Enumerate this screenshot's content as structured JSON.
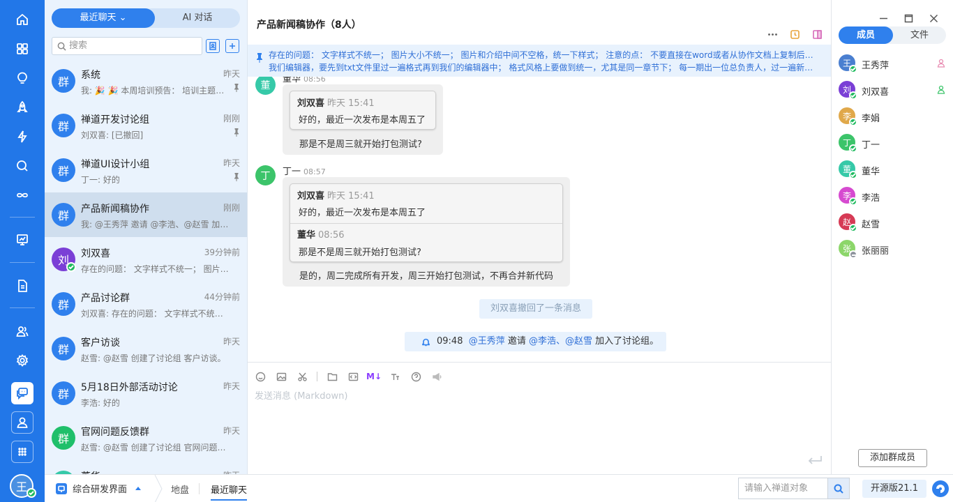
{
  "colors": {
    "brand": "#2277e8",
    "accent": "#2f80ed",
    "online": "#1fba5e"
  },
  "leftbar": {
    "icons": [
      "home-icon",
      "apps-icon",
      "lightbulb-icon",
      "rocket-icon",
      "lightning-icon",
      "search-icon",
      "infinity-icon",
      "presentation-icon",
      "document-icon",
      "users-icon",
      "gear-icon",
      "chat-icon",
      "contact-icon",
      "grid-icon"
    ],
    "user_avatar": "王"
  },
  "chatlist": {
    "tab_recent": "最近聊天",
    "tab_ai": "AI 对话",
    "search_placeholder": "搜索",
    "items": [
      {
        "avatar": "群",
        "color": "#2f80ed",
        "name": "系统",
        "time": "昨天",
        "preview": "我: 🎉 🎉 本周培训预告： 培训主题： 进阶版本功能介绍",
        "pinned": true
      },
      {
        "avatar": "群",
        "color": "#2f80ed",
        "name": "禅道开发讨论组",
        "time": "刚刚",
        "preview": "刘双喜: [已撤回]",
        "pinned": true
      },
      {
        "avatar": "群",
        "color": "#2f80ed",
        "name": "禅道UI设计小组",
        "time": "昨天",
        "preview": "丁一: 好的",
        "pinned": true
      },
      {
        "avatar": "群",
        "color": "#2f80ed",
        "name": "产品新闻稿协作",
        "time": "刚刚",
        "preview": "我: @王秀萍 邀请 @李浩、@赵雪 加入了讨论组。",
        "pinned": false,
        "selected": true
      },
      {
        "avatar": "刘",
        "color": "#7a3fd6",
        "name": "刘双喜",
        "time": "39分钟前",
        "preview": "存在的问题： 文字样式不统一； 图片大小不统一；",
        "pinned": false,
        "online": true
      },
      {
        "avatar": "群",
        "color": "#2f80ed",
        "name": "产品讨论群",
        "time": "44分钟前",
        "preview": "刘双喜: 存在的问题： 文字样式不统一； 图片大小不统一",
        "pinned": false
      },
      {
        "avatar": "群",
        "color": "#2f80ed",
        "name": "客户访谈",
        "time": "昨天",
        "preview": "赵雪: @赵雪 创建了讨论组 客户访谈。",
        "pinned": false
      },
      {
        "avatar": "群",
        "color": "#2f80ed",
        "name": "5月18日外部活动讨论",
        "time": "昨天",
        "preview": "李浩: 好的",
        "pinned": false
      },
      {
        "avatar": "群",
        "color": "#1fbf6a",
        "name": "官网问题反馈群",
        "time": "昨天",
        "preview": "赵雪: @赵雪 创建了讨论组 官网问题反馈群。",
        "pinned": false
      },
      {
        "avatar": "董",
        "color": "#36c9a8",
        "name": "董华",
        "time": "昨天",
        "preview": "",
        "pinned": false
      }
    ]
  },
  "chat": {
    "title": "产品新闻稿协作（8人）",
    "notice_line1": "存在的问题： 文字样式不统一； 图片大小不统一； 图片和介绍中间不空格，统一下样式； 注意的点： 不要直接在word或者从协作文档上复制后放入",
    "notice_line2": "我们编辑器，要先到txt文件里过一遍格式再到我们的编辑器中； 格式风格上要做到统一，尤其是同一章节下； 每一期出一位总负责人，过一遍新闻稿，检查格式",
    "msg1": {
      "sender": "董华",
      "time": "08:56",
      "avatar": "董",
      "quote_name": "刘双喜",
      "quote_time": "昨天 15:41",
      "quote_text": "好的，最近一次发布是本周五了",
      "text": "那是不是周三就开始打包测试?"
    },
    "msg2": {
      "sender": "丁一",
      "time": "08:57",
      "avatar": "丁",
      "quote_name": "刘双喜",
      "quote_time": "昨天 15:41",
      "quote_text": "好的，最近一次发布是本周五了",
      "quote2_name": "董华",
      "quote2_time": "08:56",
      "quote2_text": "那是不是周三就开始打包测试?",
      "text": "是的，周二完成所有开发，周三开始打包测试，不再合并新代码"
    },
    "recall_notice": "刘双喜撤回了一条消息",
    "sys_time": "09:48",
    "sys_inviter": "@王秀萍",
    "sys_invite": " 邀请 ",
    "sys_members": "@李浩、@赵雪",
    "sys_tail": " 加入了讨论组。",
    "input_placeholder": "发送消息 (Markdown)",
    "md_label": "M↓"
  },
  "members": {
    "tab_members": "成员",
    "tab_files": "文件",
    "list": [
      {
        "avatar": "王",
        "color": "#4a7fd0",
        "name": "王秀萍",
        "status": "online",
        "role": "owner"
      },
      {
        "avatar": "刘",
        "color": "#7a3fd6",
        "name": "刘双喜",
        "status": "online",
        "role": "admin"
      },
      {
        "avatar": "李",
        "color": "#e0a84a",
        "name": "李娟",
        "status": "online"
      },
      {
        "avatar": "丁",
        "color": "#3cc46a",
        "name": "丁一",
        "status": "online"
      },
      {
        "avatar": "董",
        "color": "#36c9a8",
        "name": "董华",
        "status": "online"
      },
      {
        "avatar": "李",
        "color": "#d64ad0",
        "name": "李浩",
        "status": "online"
      },
      {
        "avatar": "赵",
        "color": "#d63a55",
        "name": "赵雪",
        "status": "online"
      },
      {
        "avatar": "张",
        "color": "#8cd66a",
        "name": "张丽丽",
        "status": "offline"
      }
    ],
    "add_button": "添加群成员"
  },
  "bottombar": {
    "workspace": "综合研发界面",
    "tab_map": "地盘",
    "tab_chat": "最近聊天",
    "search_placeholder": "请输入禅道对象",
    "version": "开源版21.1"
  }
}
